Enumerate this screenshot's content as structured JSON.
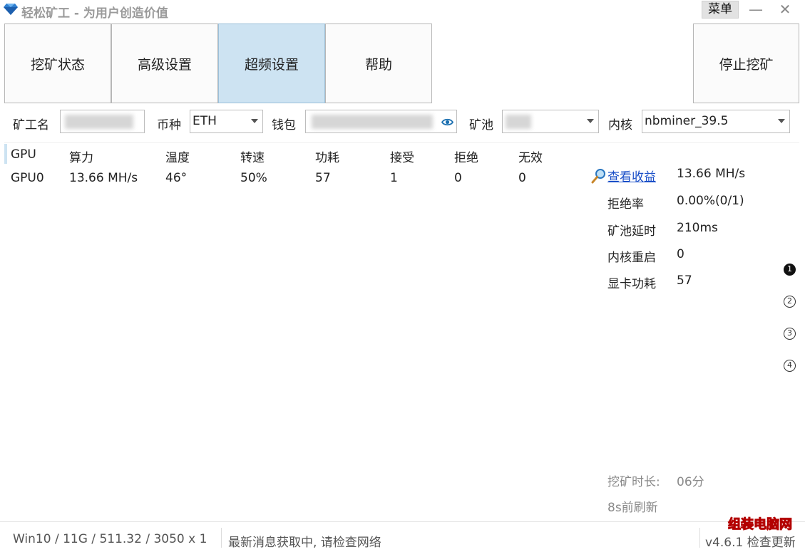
{
  "window": {
    "title": "轻松矿工 - 为用户创造价值",
    "menu_label": "菜单",
    "minimize_glyph": "—",
    "close_glyph": "✕",
    "icon": "gem-icon"
  },
  "tabs": [
    {
      "label": "挖矿状态",
      "active": false
    },
    {
      "label": "高级设置",
      "active": false
    },
    {
      "label": "超频设置",
      "active": true
    },
    {
      "label": "帮助",
      "active": false
    }
  ],
  "stop_button": "停止挖矿",
  "config": {
    "miner_name_label": "矿工名",
    "miner_name_value": "",
    "coin_label": "币种",
    "coin_value": "ETH",
    "wallet_label": "钱包",
    "wallet_value": "",
    "pool_label": "矿池",
    "pool_value": "",
    "kernel_label": "内核",
    "kernel_value": "nbminer_39.5"
  },
  "gpu_table": {
    "headers": [
      "GPU",
      "算力",
      "温度",
      "转速",
      "功耗",
      "接受",
      "拒绝",
      "无效"
    ],
    "rows": [
      [
        "GPU0",
        "13.66 MH/s",
        "46°",
        "50%",
        "57",
        "1",
        "0",
        "0"
      ]
    ]
  },
  "stats": {
    "earnings_link": "查看收益",
    "hashrate": "13.66 MH/s",
    "reject_rate_label": "拒绝率",
    "reject_rate": "0.00%(0/1)",
    "pool_latency_label": "矿池延时",
    "pool_latency": "210ms",
    "kernel_restart_label": "内核重启",
    "kernel_restart": "0",
    "gpu_power_label": "显卡功耗",
    "gpu_power": "57"
  },
  "pages": [
    "1",
    "2",
    "3",
    "4"
  ],
  "active_page": "1",
  "mining_time_label": "挖矿时长:",
  "mining_time": "06分",
  "refresh_text": "8s前刷新",
  "statusbar": {
    "system_info": "Win10  / 11G / 511.32 / 3050 x 1",
    "news": "最新消息获取中, 请检查网络",
    "version": "v4.6.1 检查更新"
  },
  "watermark": "组装电脑网",
  "colors": {
    "active_tab": "#cde3f2",
    "link": "#1a4fc8",
    "eye": "#1a6fb0"
  }
}
